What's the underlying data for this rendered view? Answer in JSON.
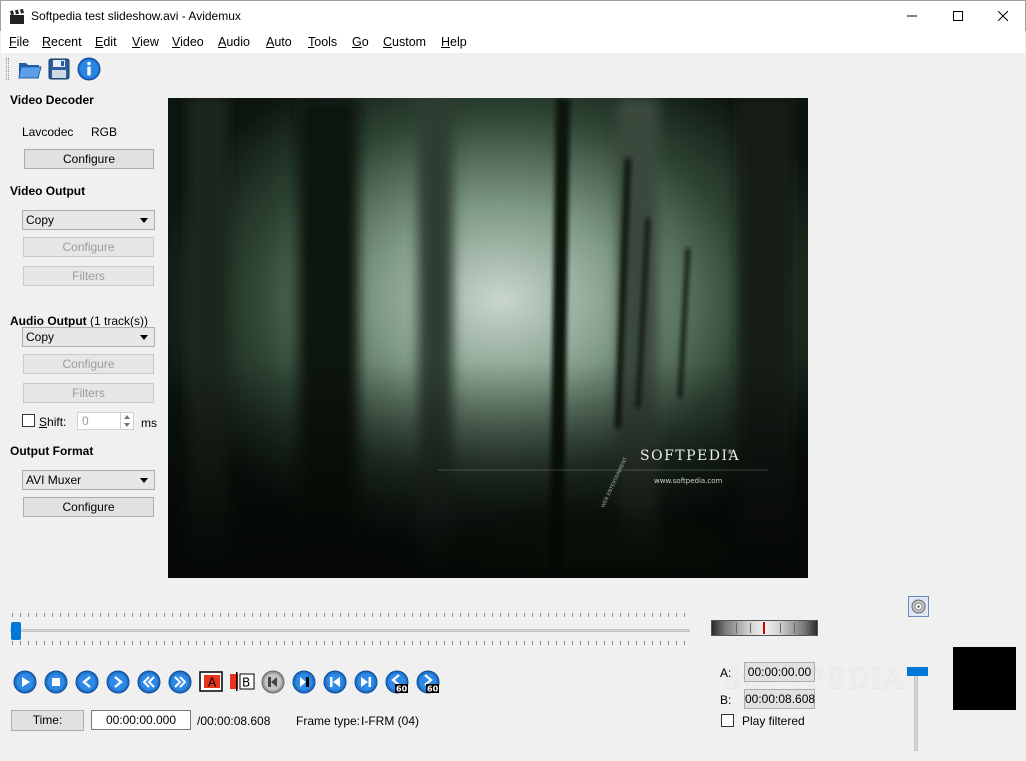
{
  "window": {
    "title": "Softpedia test slideshow.avi - Avidemux"
  },
  "menu": [
    {
      "label": "File",
      "acc": "F",
      "rest": "ile"
    },
    {
      "label": "Recent",
      "acc": "R",
      "rest": "ecent"
    },
    {
      "label": "Edit",
      "acc": "E",
      "rest": "dit"
    },
    {
      "label": "View",
      "acc": "V",
      "rest": "iew"
    },
    {
      "label": "Video",
      "acc": "V",
      "rest": "ideo"
    },
    {
      "label": "Audio",
      "acc": "A",
      "rest": "udio"
    },
    {
      "label": "Auto",
      "acc": "A",
      "rest": "uto"
    },
    {
      "label": "Tools",
      "acc": "T",
      "rest": "ools"
    },
    {
      "label": "Go",
      "acc": "G",
      "rest": "o"
    },
    {
      "label": "Custom",
      "acc": "C",
      "rest": "ustom"
    },
    {
      "label": "Help",
      "acc": "H",
      "rest": "elp"
    }
  ],
  "toolbar": {
    "icons": [
      "open-folder-icon",
      "save-disk-icon",
      "info-icon"
    ]
  },
  "video_decoder": {
    "title": "Video Decoder",
    "codec": "Lavcodec",
    "format": "RGB",
    "configure": "Configure"
  },
  "video_output": {
    "title": "Video Output",
    "selected": "Copy",
    "configure": "Configure",
    "filters": "Filters"
  },
  "audio_output": {
    "title": "Audio Output",
    "tracks": "(1 track(s))",
    "selected": "Copy",
    "configure": "Configure",
    "filters": "Filters",
    "shift_label": "Shift:",
    "shift_acc": "S",
    "shift_rest": "hift:",
    "shift_value": "0",
    "shift_unit": "ms",
    "shift_checked": false
  },
  "output_format": {
    "title": "Output Format",
    "selected": "AVI Muxer",
    "configure": "Configure"
  },
  "preview": {
    "brand": "SOFTPEDIA",
    "trademark": "®",
    "url": "www.softpedia.com",
    "tag": "WEB ENTERTAINMENT"
  },
  "navigation": {
    "position_fraction": 0.0
  },
  "markers": {
    "a_label": "A:",
    "a_value": "00:00:00.00",
    "b_label": "B:",
    "b_value": "00:00:08.608",
    "play_filtered": "Play filtered",
    "play_filtered_checked": false
  },
  "status": {
    "time_button": "Time:",
    "current_time": "00:00:00.000",
    "duration": "/00:00:08.608",
    "frame_type_label": "Frame type:",
    "frame_type": "I-FRM (04)"
  },
  "watermark": "SOFTPEDIA",
  "colors": {
    "accent": "#0078d7",
    "control_blue": "#1e73c8",
    "marker_red": "#e8331d"
  }
}
